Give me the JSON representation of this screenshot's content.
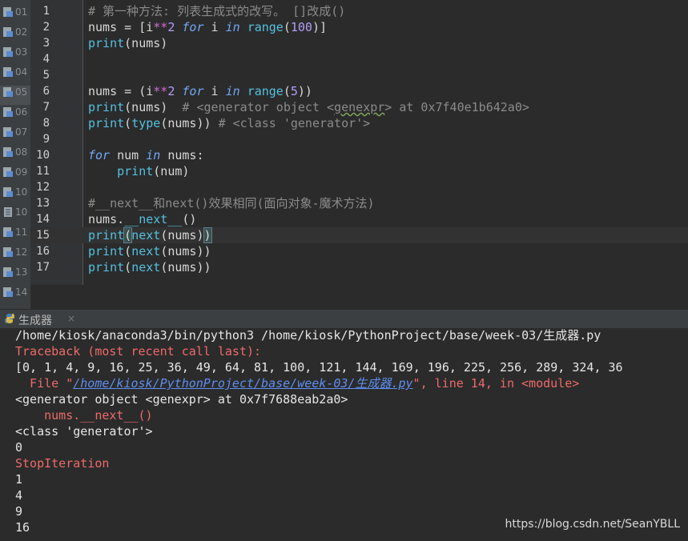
{
  "project_tree": {
    "items": [
      "01",
      "02",
      "03",
      "04",
      "05",
      "06",
      "07",
      "08",
      "09",
      "10",
      "10",
      "11",
      "12",
      "13",
      "14"
    ]
  },
  "editor": {
    "line_numbers": [
      "1",
      "2",
      "3",
      "4",
      "5",
      "6",
      "7",
      "8",
      "9",
      "10",
      "11",
      "12",
      "13",
      "14",
      "15",
      "16",
      "17"
    ],
    "code": {
      "l1_comment": "# 第一种方法: 列表生成式的改写。 []改成()",
      "l2_a": "nums = [i",
      "l2_op": "**",
      "l2_n": "2",
      "l2_for": "for",
      "l2_i": " i ",
      "l2_in": "in",
      "l2_range": "range",
      "l2_paren": "(",
      "l2_num": "100",
      "l2_end": ")]",
      "l3_fn": "print",
      "l3_args": "(nums)",
      "l6_a": "nums = (i",
      "l6_op": "**",
      "l6_n": "2",
      "l6_for": "for",
      "l6_i": " i ",
      "l6_in": "in",
      "l6_range": "range",
      "l6_paren": "(",
      "l6_num": "5",
      "l6_end": "))",
      "l7_fn": "print",
      "l7_args": "(nums)",
      "l7_c1": "# <generator object <",
      "l7_c2": "genexpr",
      "l7_c3": "> at 0x7f40e1b642a0>",
      "l8_fn": "print",
      "l8_p": "(",
      "l8_type": "type",
      "l8_args": "(nums))",
      "l8_comment": "# <class 'generator'>",
      "l10_for": "for",
      "l10_mid": " num ",
      "l10_in": "in",
      "l10_end": " nums:",
      "l11_fn": "print",
      "l11_args": "(num)",
      "l13_comment": "#__next__和next()效果相同(面向对象-魔术方法)",
      "l14_a": "nums.",
      "l14_m": "__next__",
      "l14_end": "()",
      "l15_fn": "print",
      "l15_p": "(",
      "l15_next": "next",
      "l15_args": "(nums)",
      "l15_close": ")",
      "l16_fn": "print",
      "l16_p": "(",
      "l16_next": "next",
      "l16_args": "(nums))",
      "l17_fn": "print",
      "l17_p": "(",
      "l17_next": "next",
      "l17_args": "(nums))"
    }
  },
  "run_panel": {
    "title": "生成器",
    "close": "×",
    "lines": {
      "cmd": "/home/kiosk/anaconda3/bin/python3 /home/kiosk/PythonProject/base/week-03/生成器.py",
      "traceback": "Traceback (most recent call last):",
      "list_output": "[0, 1, 4, 9, 16, 25, 36, 49, 64, 81, 100, 121, 144, 169, 196, 225, 256, 289, 324, 36",
      "file_prefix": "  File \"",
      "file_link": "/home/kiosk/PythonProject/base/week-03/生成器.py",
      "file_suffix": "\", line 14, in <module>",
      "gen_obj": "<generator object <genexpr> at 0x7f7688eab2a0>",
      "next_call": "    nums.__next__()",
      "class_gen": "<class 'generator'>",
      "v0": "0",
      "stop_iter": "StopIteration",
      "v1": "1",
      "v4": "4",
      "v9": "9",
      "v16": "16"
    }
  },
  "watermark": "https://blog.csdn.net/SeanYBLL",
  "colors": {
    "background": "#2b2b2b",
    "keyword": "#73a8f5",
    "builtin": "#54c1e0",
    "number": "#b29ef7",
    "error": "#ee6a6a",
    "link": "#5f8ef0"
  }
}
